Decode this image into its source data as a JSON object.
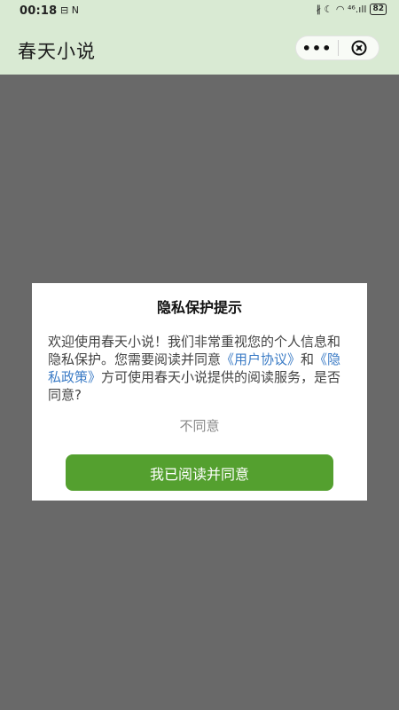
{
  "status_bar": {
    "time": "00:18",
    "left_icons": "⊟ N",
    "right_icons": "∦ ☾ ◠ ⁴⁶.ıll",
    "battery": "82"
  },
  "header": {
    "title": "春天小说",
    "more_label": "•••"
  },
  "dialog": {
    "title": "隐私保护提示",
    "body_part1": "欢迎使用春天小说！我们非常重视您的个人信息和隐私保护。您需要阅读并同意",
    "user_agreement": "《用户协议》",
    "and": "和",
    "privacy_policy": "《隐私政策》",
    "body_part2": "方可使用春天小说提供的阅读服务，是否同意?",
    "disagree_label": "不同意",
    "agree_label": "我已阅读并同意"
  },
  "colors": {
    "header_bg": "#d9ead3",
    "overlay": "#696969",
    "accent": "#54a02f",
    "link": "#3c7cc6"
  }
}
